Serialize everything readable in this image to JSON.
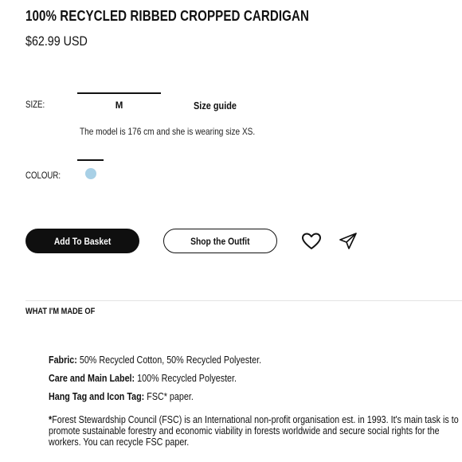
{
  "product": {
    "title": "100% RECYCLED RIBBED CROPPED CARDIGAN",
    "price": "$62.99 USD"
  },
  "size": {
    "label": "SIZE:",
    "selected": "M",
    "guide_link": "Size guide",
    "model_note": "The model is 176 cm and she is wearing size XS."
  },
  "colour": {
    "label": "COLOUR:",
    "swatch_color": "#a8d0e6"
  },
  "actions": {
    "add_to_basket": "Add To Basket",
    "shop_outfit": "Shop the Outfit",
    "wishlist_icon": "heart-icon",
    "share_icon": "send-icon"
  },
  "materials": {
    "section_title": "WHAT I'M MADE OF",
    "fabric_label": "Fabric:",
    "fabric_value": "50% Recycled Cotton, 50% Recycled Polyester.",
    "care_label": "Care and Main Label:",
    "care_value": "100% Recycled Polyester.",
    "tag_label": "Hang Tag and Icon Tag:",
    "tag_value": "FSC* paper.",
    "fsc_star": "*",
    "fsc_note": "Forest Stewardship Council (FSC) is an International non-profit organisation est. in 1993. It's main task is to promote sustainable forestry and economic viability in forests worldwide and secure social rights for the workers. You can recycle FSC paper."
  }
}
